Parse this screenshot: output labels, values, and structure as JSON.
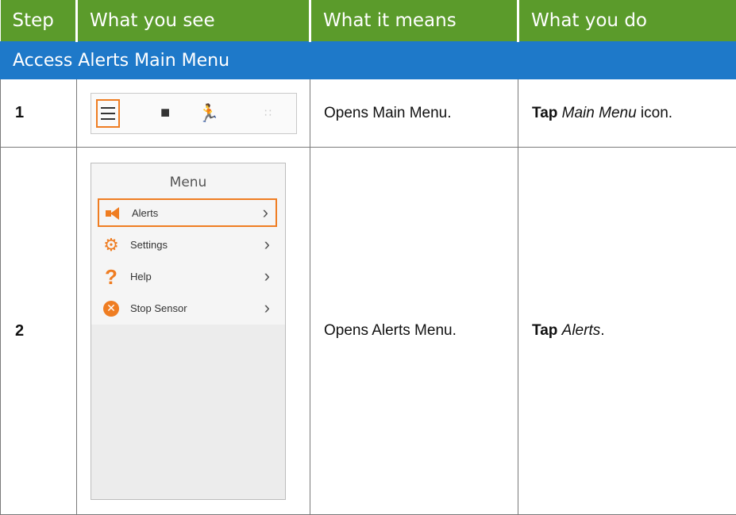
{
  "header": {
    "col_step": "Step",
    "col_see": "What you see",
    "col_means": "What it means",
    "col_do": "What you do"
  },
  "section": {
    "title": "Access Alerts Main Menu"
  },
  "rows": [
    {
      "step": "1",
      "means": "Opens Main Menu.",
      "do_bold": "Tap",
      "do_italic": "Main Menu",
      "do_rest": " icon.",
      "toolbar_icons": [
        "main-menu-icon",
        "sensor-pin-icon",
        "activity-runner-icon",
        "dots-icon"
      ]
    },
    {
      "step": "2",
      "means": "Opens Alerts Menu.",
      "do_bold": "Tap",
      "do_italic": "Alerts",
      "do_rest": ".",
      "screen": {
        "title": "Menu",
        "items": [
          {
            "label": "Alerts",
            "icon": "alert-megaphone-icon",
            "selected": true
          },
          {
            "label": "Settings",
            "icon": "gear-icon",
            "selected": false
          },
          {
            "label": "Help",
            "icon": "question-icon",
            "selected": false
          },
          {
            "label": "Stop Sensor",
            "icon": "stop-sensor-icon",
            "selected": false
          }
        ]
      }
    }
  ],
  "colors": {
    "header_green": "#5b9b2b",
    "section_blue": "#1e79c9",
    "highlight_orange": "#ef7d22"
  }
}
